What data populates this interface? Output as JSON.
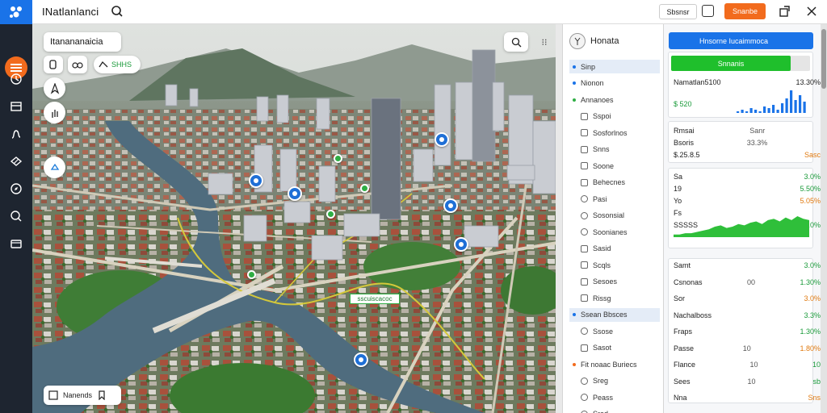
{
  "app": {
    "title": "INatlanlanci"
  },
  "toolbar": {
    "outline_button": "Sbsnsr",
    "orange_button": "Snanbe"
  },
  "rail": {
    "icons": [
      "menu-icon",
      "clock-icon",
      "card-icon",
      "route-icon",
      "layers-icon",
      "compass-icon",
      "search-icon",
      "folder-icon"
    ]
  },
  "map": {
    "place_label": "Itanananaicia",
    "green_pill": "SHHS",
    "road_label": "sscuiscacoc",
    "bottom_label": "Nanends",
    "colors": {
      "water": "#4f6c7e",
      "park": "#3f7d36",
      "road": "#d8d2bf",
      "route_line": "#d4c83a"
    }
  },
  "middle": {
    "header": "Honata",
    "items": [
      {
        "label": "Sinp",
        "marker": "dot",
        "highlight": true
      },
      {
        "label": "Nionon",
        "marker": "dot",
        "highlight": false
      },
      {
        "label": "Annanoes",
        "marker": "gdot",
        "highlight": false
      },
      {
        "label": "Sspoi",
        "marker": "sq",
        "highlight": false
      },
      {
        "label": "Sosforlnos",
        "marker": "sq",
        "highlight": false
      },
      {
        "label": "Snns",
        "marker": "sq",
        "highlight": false
      },
      {
        "label": "Soone",
        "marker": "sq",
        "highlight": false
      },
      {
        "label": "Behecnes",
        "marker": "sq",
        "highlight": false
      },
      {
        "label": "Pasi",
        "marker": "cr",
        "highlight": false
      },
      {
        "label": "Sosonsial",
        "marker": "cr",
        "highlight": false
      },
      {
        "label": "Soonianes",
        "marker": "cr",
        "highlight": false
      },
      {
        "label": "Sasid",
        "marker": "sq",
        "highlight": false
      },
      {
        "label": "Scqls",
        "marker": "sq",
        "highlight": false
      },
      {
        "label": "Sesoes",
        "marker": "sq",
        "highlight": false
      },
      {
        "label": "Rissg",
        "marker": "sq",
        "highlight": false
      },
      {
        "label": "Ssean Bbsces",
        "marker": "dot",
        "highlight": true
      },
      {
        "label": "Ssose",
        "marker": "cr",
        "highlight": false
      },
      {
        "label": "Sasot",
        "marker": "sq",
        "highlight": false
      },
      {
        "label": "Fit noaac Buriecs",
        "marker": "odot",
        "highlight": false
      },
      {
        "label": "Sreg",
        "marker": "cr",
        "highlight": false
      },
      {
        "label": "Peass",
        "marker": "cr",
        "highlight": false
      },
      {
        "label": "Srad",
        "marker": "cr",
        "highlight": false
      }
    ]
  },
  "right": {
    "header": "Hnsorne Iucaimmoca",
    "progress": {
      "label": "Snnanis",
      "value": 0.86
    },
    "stat1": {
      "name": "Namatlan5100",
      "pct": "13.30%",
      "value": "$ 520",
      "bars": [
        1,
        2,
        1,
        3,
        2,
        1,
        4,
        3,
        5,
        2,
        6,
        9,
        14,
        8,
        11,
        7
      ]
    },
    "card2": [
      {
        "a": "Rmsai",
        "b": "Sanr",
        "c": ""
      },
      {
        "a": "Bsoris",
        "b": "33.3%",
        "c": ""
      },
      {
        "a": "$.25.8.5",
        "b": "",
        "c": "Sasc"
      }
    ],
    "card3": {
      "rows": [
        {
          "a": "Sa",
          "b": "3.0%"
        },
        {
          "a": "19",
          "b": "5.50%"
        },
        {
          "a": "Yo",
          "b": "5.05%"
        },
        {
          "a": "Fs",
          "b": ""
        },
        {
          "a": "SSSSS",
          "b": "3.0%"
        }
      ],
      "area": [
        2,
        2,
        3,
        3,
        4,
        5,
        6,
        8,
        9,
        7,
        8,
        10,
        9,
        11,
        12,
        10,
        13,
        14,
        12,
        15,
        13,
        16,
        14,
        13
      ]
    },
    "card4": [
      {
        "a": "Samt",
        "b": "",
        "c": "3.0%"
      },
      {
        "a": "Csnonas",
        "b": "00",
        "c": "1.30%"
      },
      {
        "a": "Sor",
        "b": "",
        "c": "3.0%"
      },
      {
        "a": "Nachalboss",
        "b": "",
        "c": "3.3%"
      },
      {
        "a": "Fraps",
        "b": "",
        "c": "1.30%"
      },
      {
        "a": "Passe",
        "b": "10",
        "c": "1.80%"
      },
      {
        "a": "Flance",
        "b": "10",
        "c": "10"
      },
      {
        "a": "Sees",
        "b": "10",
        "c": "sb"
      },
      {
        "a": "Nna",
        "b": "",
        "c": "Sns"
      }
    ]
  }
}
